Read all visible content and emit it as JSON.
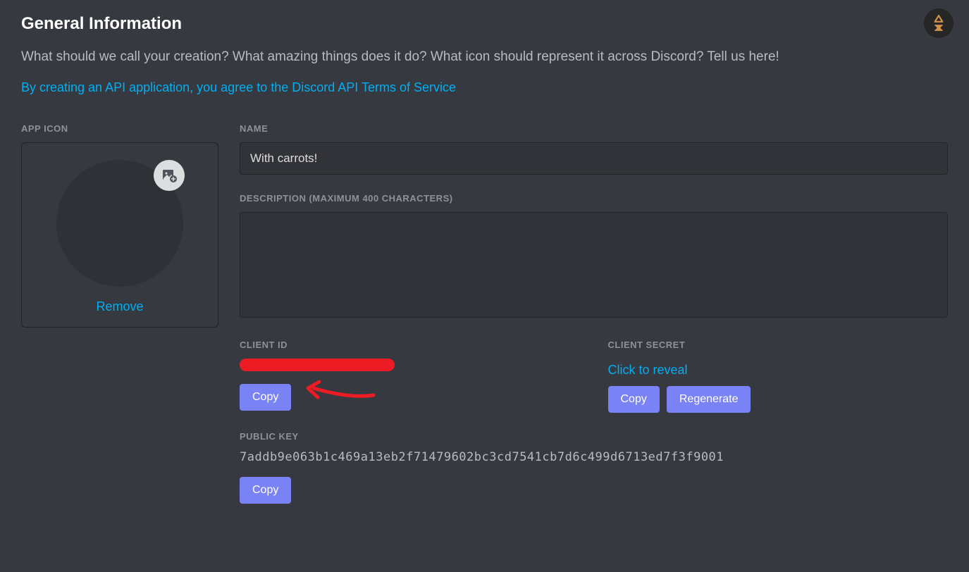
{
  "header": {
    "title": "General Information",
    "subtitle": "What should we call your creation? What amazing things does it do? What icon should represent it across Discord? Tell us here!",
    "tos_link": "By creating an API application, you agree to the Discord API Terms of Service"
  },
  "app_icon": {
    "label": "APP ICON",
    "remove": "Remove"
  },
  "name": {
    "label": "NAME",
    "value": "With carrots!"
  },
  "description": {
    "label": "DESCRIPTION (MAXIMUM 400 CHARACTERS)",
    "value": ""
  },
  "client_id": {
    "label": "CLIENT ID",
    "copy": "Copy"
  },
  "client_secret": {
    "label": "CLIENT SECRET",
    "reveal": "Click to reveal",
    "copy": "Copy",
    "regenerate": "Regenerate"
  },
  "public_key": {
    "label": "PUBLIC KEY",
    "value": "7addb9e063b1c469a13eb2f71479602bc3cd7541cb7d6c499d6713ed7f3f9001",
    "copy": "Copy"
  }
}
